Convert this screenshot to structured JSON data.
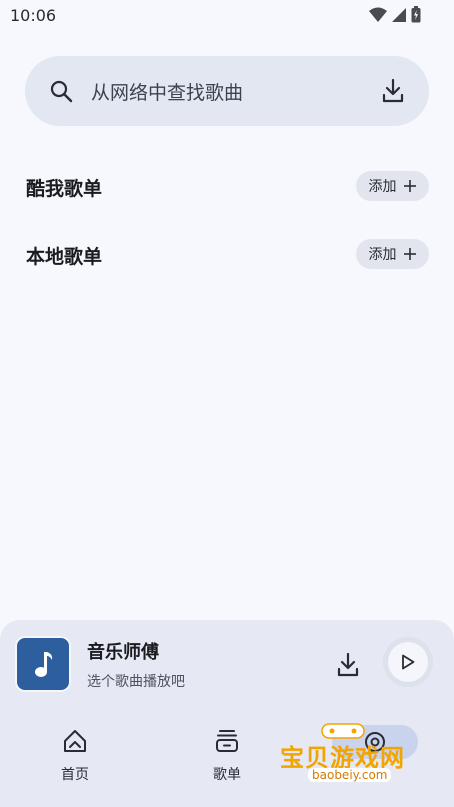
{
  "status_bar": {
    "time": "10:06"
  },
  "search": {
    "placeholder": "从网络中查找歌曲"
  },
  "sections": [
    {
      "title": "酷我歌单",
      "add_label": "添加"
    },
    {
      "title": "本地歌单",
      "add_label": "添加"
    }
  ],
  "player": {
    "title": "音乐师傅",
    "subtitle": "选个歌曲播放吧"
  },
  "nav": [
    {
      "label": "首页",
      "icon": "home-icon"
    },
    {
      "label": "歌单",
      "icon": "playlist-icon"
    },
    {
      "label": "",
      "icon": "settings-icon"
    }
  ],
  "watermark": {
    "cn": "宝贝游戏网",
    "en": "baobeiy.com"
  },
  "colors": {
    "accent": "#2d5e9e",
    "pill": "#c9d3ee",
    "background": "#f6f8fe"
  }
}
